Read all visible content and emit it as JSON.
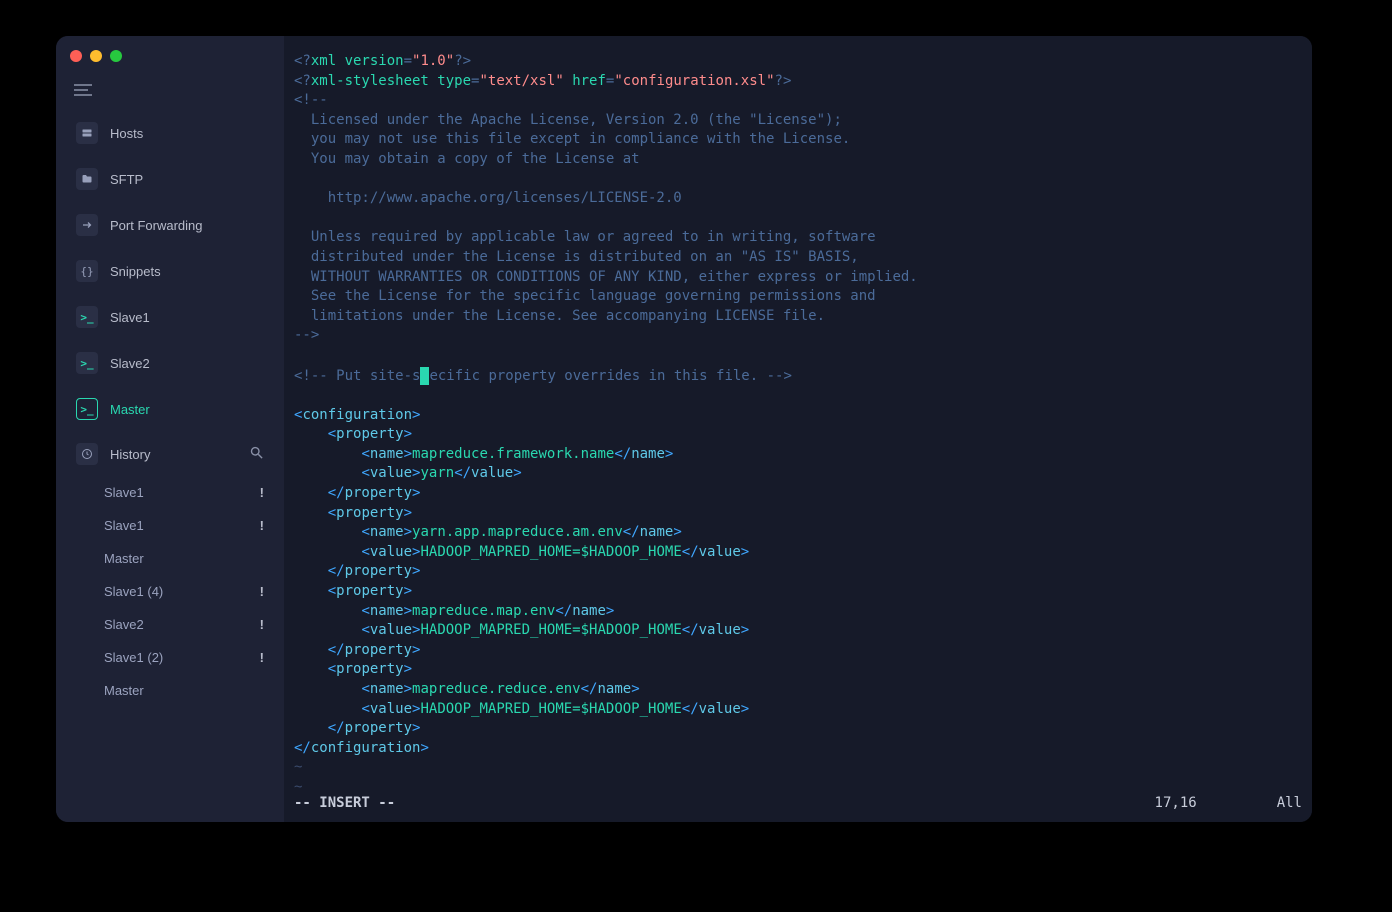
{
  "sidebar": {
    "items": [
      {
        "label": "Hosts"
      },
      {
        "label": "SFTP"
      },
      {
        "label": "Port Forwarding"
      },
      {
        "label": "Snippets"
      },
      {
        "label": "Slave1"
      },
      {
        "label": "Slave2"
      },
      {
        "label": "Master"
      },
      {
        "label": "History"
      }
    ],
    "history": [
      {
        "label": "Slave1",
        "bang": "!"
      },
      {
        "label": "Slave1",
        "bang": "!"
      },
      {
        "label": "Master",
        "bang": ""
      },
      {
        "label": "Slave1 (4)",
        "bang": "!"
      },
      {
        "label": "Slave2",
        "bang": "!"
      },
      {
        "label": "Slave1 (2)",
        "bang": "!"
      },
      {
        "label": "Master",
        "bang": ""
      }
    ]
  },
  "editor": {
    "xml_version": "1.0",
    "xsl_type": "text/xsl",
    "xsl_href": "configuration.xsl",
    "license_lines": {
      "l1": "  Licensed under the Apache License, Version 2.0 (the \"License\");",
      "l2": "  you may not use this file except in compliance with the License.",
      "l3": "  You may obtain a copy of the License at",
      "l4": "    http://www.apache.org/licenses/LICENSE-2.0",
      "l5": "  Unless required by applicable law or agreed to in writing, software",
      "l6": "  distributed under the License is distributed on an \"AS IS\" BASIS,",
      "l7": "  WITHOUT WARRANTIES OR CONDITIONS OF ANY KIND, either express or implied.",
      "l8": "  See the License for the specific language governing permissions and",
      "l9": "  limitations under the License. See accompanying LICENSE file."
    },
    "override_comment_before": "<!-- Put site-s",
    "override_comment_after": "ecific property overrides in this file. -->",
    "props": [
      {
        "name": "mapreduce.framework.name",
        "value": "yarn"
      },
      {
        "name": "yarn.app.mapreduce.am.env",
        "value": "HADOOP_MAPRED_HOME=$HADOOP_HOME"
      },
      {
        "name": "mapreduce.map.env",
        "value": "HADOOP_MAPRED_HOME=$HADOOP_HOME"
      },
      {
        "name": "mapreduce.reduce.env",
        "value": "HADOOP_MAPRED_HOME=$HADOOP_HOME"
      }
    ]
  },
  "status": {
    "mode": "-- INSERT --",
    "position": "17,16",
    "scroll": "All"
  }
}
